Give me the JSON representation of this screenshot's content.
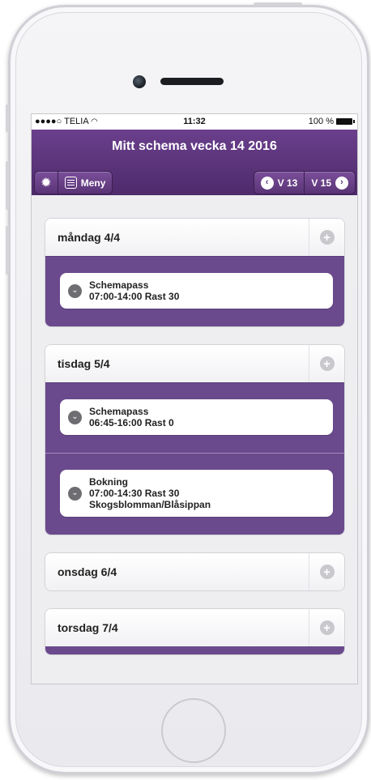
{
  "status": {
    "carrier": "TELIA",
    "time": "11:32",
    "battery": "100 %"
  },
  "header": {
    "title": "Mitt schema vecka 14  2016",
    "menu_label": "Meny",
    "prev_week": "V 13",
    "next_week": "V 15"
  },
  "days": [
    {
      "label": "måndag 4/4",
      "entries": [
        {
          "lines": [
            "Schemapass",
            "07:00-14:00 Rast 30"
          ]
        }
      ]
    },
    {
      "label": "tisdag 5/4",
      "entries": [
        {
          "lines": [
            "Schemapass",
            "06:45-16:00 Rast 0"
          ]
        },
        {
          "lines": [
            "Bokning",
            "07:00-14:30 Rast 30",
            "Skogsblomman/Blåsippan"
          ]
        }
      ]
    },
    {
      "label": "onsdag 6/4",
      "entries": []
    },
    {
      "label": "torsdag 7/4",
      "entries": []
    }
  ],
  "icons": {
    "settings": "gear-icon",
    "menu": "menu-icon",
    "prev": "chevron-left-icon",
    "next": "chevron-right-icon",
    "add": "plus-icon",
    "expand": "chevron-down-icon"
  },
  "colors": {
    "header": "#5a3476",
    "day_body": "#6a4a8d"
  }
}
